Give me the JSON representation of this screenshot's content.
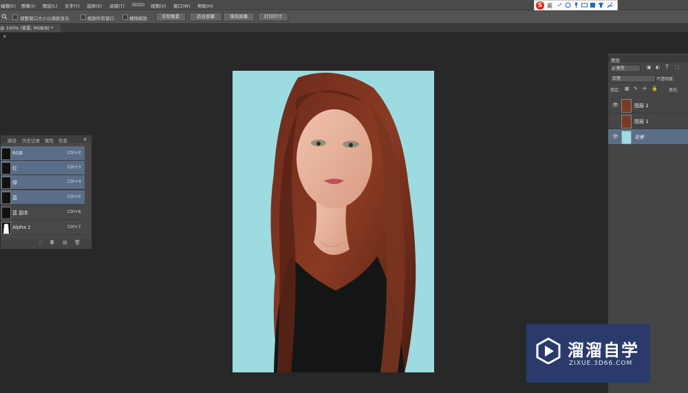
{
  "menu": [
    "编辑(E)",
    "图像(I)",
    "图层(L)",
    "文字(Y)",
    "选择(S)",
    "滤镜(T)",
    "3D(D)",
    "视图(V)",
    "窗口(W)",
    "帮助(H)"
  ],
  "options": {
    "zoom_icon": "magnifier-icon",
    "checkbox1": "调整窗口大小以满屏显示",
    "checkbox2": "缩放所有窗口",
    "checkbox3": "细微缩放",
    "buttons": [
      "实际像素",
      "适合屏幕",
      "填充屏幕",
      "打印尺寸"
    ]
  },
  "ime": {
    "logo": "S",
    "label": "英"
  },
  "doc_tab": {
    "title": "@ 100% (背景, RGB/8) *",
    "close": "×"
  },
  "channels_panel": {
    "tabs": [
      "路径",
      "历史记录",
      "属性",
      "信息"
    ],
    "rows": [
      {
        "name": "RGB",
        "shortcut": "Ctrl+2",
        "selected": true
      },
      {
        "name": "红",
        "shortcut": "Ctrl+3",
        "selected": true
      },
      {
        "name": "绿",
        "shortcut": "Ctrl+4",
        "selected": true
      },
      {
        "name": "蓝",
        "shortcut": "Ctrl+5",
        "selected": true
      },
      {
        "name": "蓝 副本",
        "shortcut": "Ctrl+6",
        "selected": false
      },
      {
        "name": "Alpha 1",
        "shortcut": "Ctrl+7",
        "selected": false
      }
    ]
  },
  "layers_panel": {
    "title": "图层",
    "filter": "ρ 类型",
    "blend": "正常",
    "opacity_label": "不透明度:",
    "lock_label": "锁定:",
    "fill_label": "填充:",
    "layers": [
      {
        "name": "图层 2",
        "visible": true,
        "selected": false
      },
      {
        "name": "图层 1",
        "visible": false,
        "selected": false
      },
      {
        "name": "背景",
        "visible": true,
        "selected": true
      }
    ]
  },
  "watermark": {
    "brand": "溜溜自学",
    "url": "ZIXUE.3D66.COM"
  },
  "colors": {
    "canvas_bg": "#9cdbe0",
    "selection": "#5b6e88",
    "watermark_bg": "#2a3b6b"
  }
}
